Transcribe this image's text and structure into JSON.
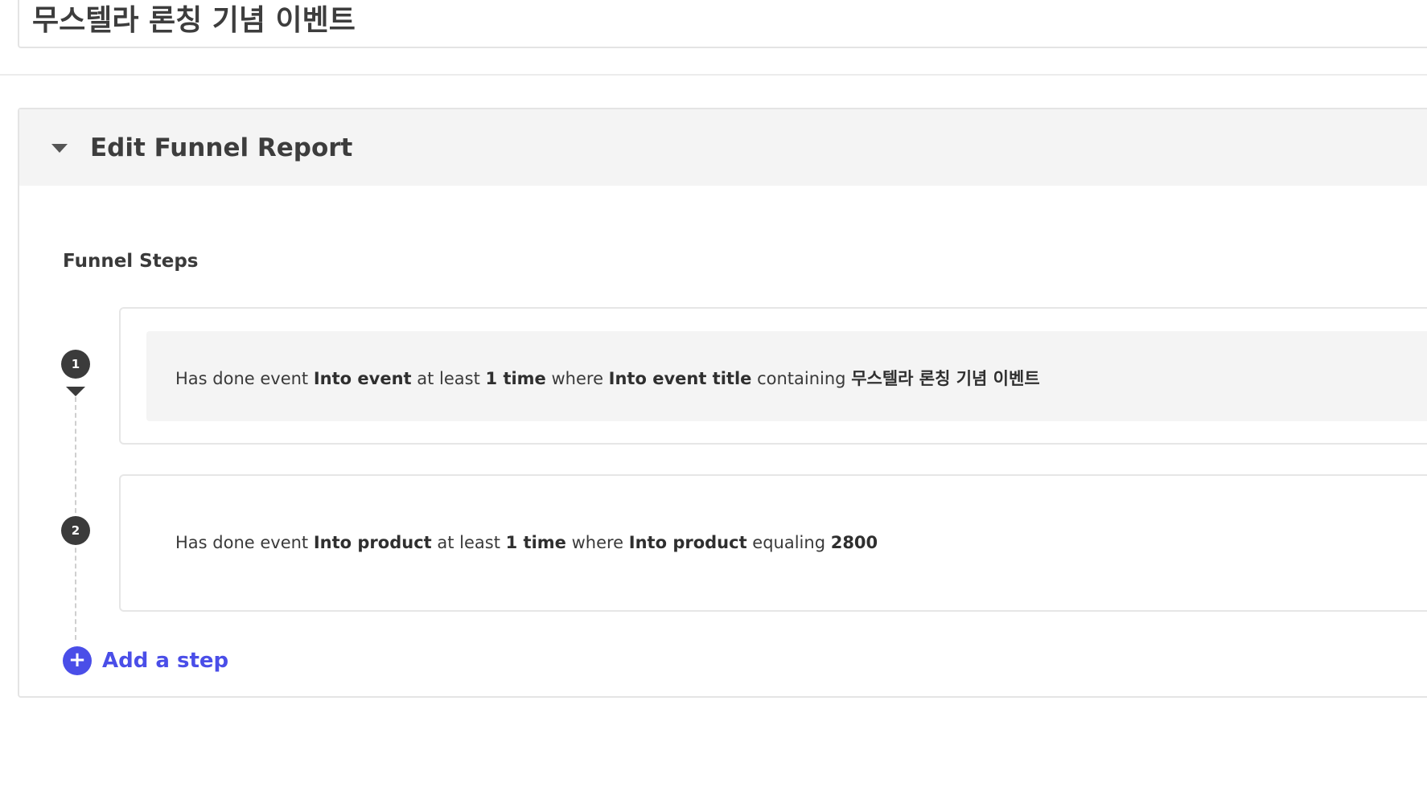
{
  "page": {
    "title": "무스텔라 론칭 기념 이벤트"
  },
  "panel": {
    "title": "Edit Funnel Report",
    "section_label": "Funnel Steps",
    "add_step_label": "Add a step",
    "add_step_icon": "plus-icon"
  },
  "steps": [
    {
      "number": "1",
      "parts": {
        "p0": "Has done event ",
        "p1": "Into event",
        "p2": " at least ",
        "p3": "1 time",
        "p4": " where ",
        "p5": "Into event title",
        "p6": " containing ",
        "p7": "무스텔라 론칭 기념 이벤트"
      }
    },
    {
      "number": "2",
      "parts": {
        "p0": "Has done event ",
        "p1": "Into product",
        "p2": " at least ",
        "p3": "1 time",
        "p4": " where ",
        "p5": "Into product",
        "p6": " equaling ",
        "p7": "2800"
      }
    }
  ],
  "colors": {
    "accent": "#4a4ee8",
    "badge": "#3b3b3b",
    "header_bg": "#f4f4f4"
  }
}
